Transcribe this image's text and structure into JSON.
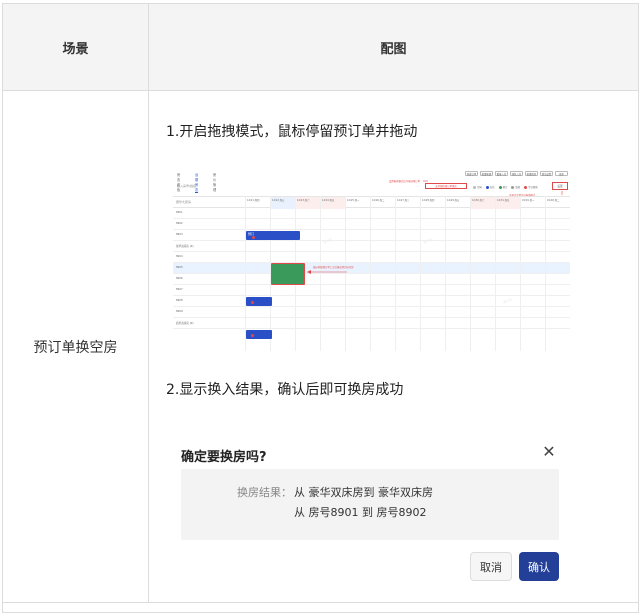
{
  "table": {
    "header": {
      "scene": "场景",
      "image": "配图"
    },
    "row": {
      "scene": "预订单换空房",
      "step1": "1.开启拖拽模式，鼠标停留预订单并拖动",
      "step2": "2.显示换入结果，确认后即可换房成功"
    }
  },
  "screenshot": {
    "tabs": [
      "房态看板",
      "远期房态",
      "房价管理"
    ],
    "toolbar_buttons": [
      "新建订单",
      "批量新建",
      "散客入住",
      "团队入住",
      "批量排房",
      "清洁设置",
      "更多"
    ],
    "search_placeholder": "输入房号/姓名",
    "drag_mode_label": "支持拖拽预订单换房",
    "legend": [
      "空闲",
      "在住",
      "预订",
      "维修",
      "今日预离"
    ],
    "settings_label": "设置",
    "note_top": "设置拖拽模式后可拖动预订单",
    "note_right": "可通过设置开启拖拽模式",
    "note_middle": "鼠标停留预订单上方后拖动到目标空房",
    "days": [
      "12/21 周四",
      "12/22 周五",
      "12/23 周六",
      "12/24 周日",
      "12/25 周一",
      "12/26 周二",
      "12/27 周三",
      "12/28 周四",
      "12/29 周五",
      "12/30 周六",
      "12/31 周日",
      "01/01 周一",
      "01/02 周二"
    ],
    "rooms": [
      "豪华大床房",
      "8901",
      "8902",
      "8903",
      "豪华双床房 (9)",
      "8904",
      "8905",
      "8906",
      "8907",
      "8908",
      "8909",
      "商务双床房 (9)"
    ],
    "booking_label": "预订"
  },
  "dialog": {
    "title": "确定要换房吗?",
    "result_label": "换房结果：",
    "line1": "从 豪华双床房到 豪华双床房",
    "line2": "从 房号8901 到 房号8902",
    "cancel": "取消",
    "confirm": "确认"
  },
  "colors": {
    "booking_blue": "#2b4fc6",
    "booking_green": "#3a9a5c",
    "annotation_red": "#e24a4a",
    "confirm_button": "#233f97"
  }
}
